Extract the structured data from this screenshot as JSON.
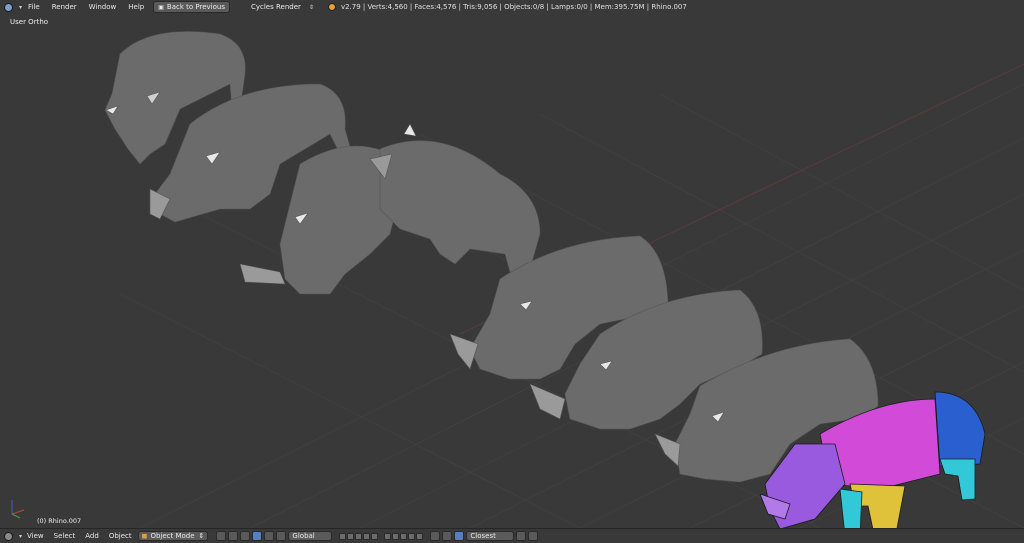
{
  "topbar": {
    "info_icon": "info-icon",
    "menus": [
      "File",
      "Render",
      "Window",
      "Help"
    ],
    "back_button": "Back to Previous",
    "render_engine": "Cycles Render",
    "stats": "v2.79 | Verts:4,560 | Faces:4,576 | Tris:9,056 | Objects:0/8 | Lamps:0/0 | Mem:395.75M | Rhino.007"
  },
  "viewport": {
    "view_label": "User Ortho",
    "object_label": "(0) Rhino.007"
  },
  "bottombar": {
    "view_menu": "View",
    "select_menu": "Select",
    "add_menu": "Add",
    "object_menu": "Object",
    "mode": "Object Mode",
    "transform_orientation": "Global",
    "snap_target": "Closest"
  },
  "colors": {
    "background": "#393939",
    "rhino_gray": "#6c6c6c",
    "uv_magenta": "#d24ad8",
    "uv_blue": "#2a5fd0",
    "uv_yellow": "#e0c23a",
    "uv_cyan": "#33c8d8",
    "uv_purple": "#9a5ae0"
  }
}
